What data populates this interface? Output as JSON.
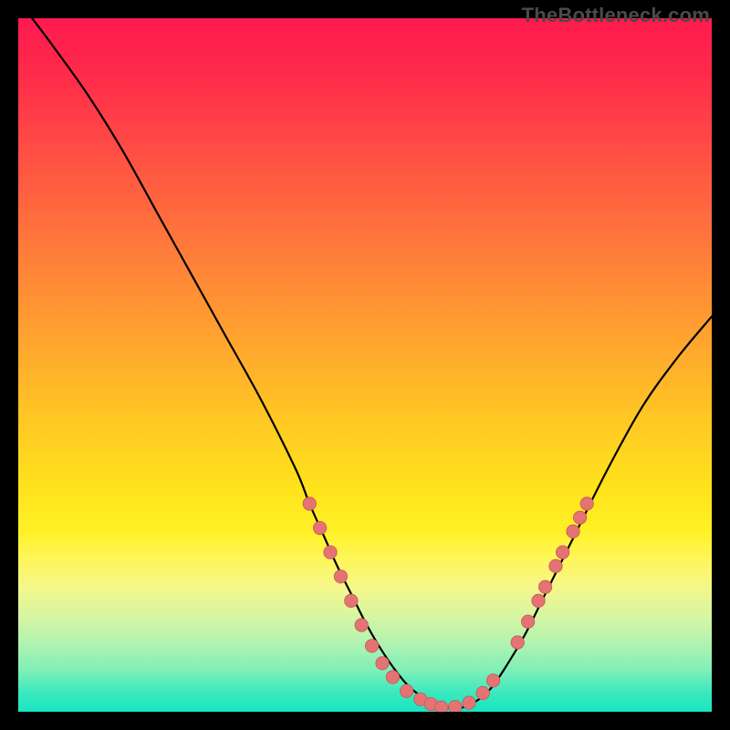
{
  "watermark": "TheBottleneck.com",
  "colors": {
    "background": "#000000",
    "gradient_top": "#ff1a4f",
    "gradient_bottom": "#16e6c0",
    "curve": "#000000",
    "dot_fill": "#e57373",
    "dot_stroke": "#c45a5a"
  },
  "chart_data": {
    "type": "line",
    "title": "",
    "xlabel": "",
    "ylabel": "",
    "xlim": [
      0,
      100
    ],
    "ylim": [
      0,
      100
    ],
    "grid": false,
    "legend": false,
    "series": [
      {
        "name": "bottleneck-curve",
        "x": [
          2,
          5,
          10,
          15,
          20,
          25,
          30,
          35,
          40,
          42,
          44,
          46,
          48,
          50,
          52,
          54,
          56,
          58,
          60,
          62,
          64,
          66,
          68,
          70,
          73,
          76,
          80,
          85,
          90,
          95,
          100
        ],
        "y": [
          100,
          96,
          89,
          81,
          72,
          63,
          54,
          45,
          35,
          30,
          25.5,
          21,
          17,
          13,
          9.5,
          6.5,
          4,
          2.3,
          1.2,
          0.6,
          0.6,
          1.5,
          3.2,
          6,
          11,
          17,
          25,
          35,
          44,
          51,
          57
        ]
      }
    ],
    "highlight_dots": {
      "name": "marked-points",
      "points": [
        {
          "x": 42,
          "y": 30
        },
        {
          "x": 43.5,
          "y": 26.5
        },
        {
          "x": 45,
          "y": 23
        },
        {
          "x": 46.5,
          "y": 19.5
        },
        {
          "x": 48,
          "y": 16
        },
        {
          "x": 49.5,
          "y": 12.5
        },
        {
          "x": 51,
          "y": 9.5
        },
        {
          "x": 52.5,
          "y": 7
        },
        {
          "x": 54,
          "y": 5
        },
        {
          "x": 56,
          "y": 3
        },
        {
          "x": 58,
          "y": 1.8
        },
        {
          "x": 59.5,
          "y": 1.1
        },
        {
          "x": 61,
          "y": 0.6
        },
        {
          "x": 63,
          "y": 0.7
        },
        {
          "x": 65,
          "y": 1.3
        },
        {
          "x": 67,
          "y": 2.7
        },
        {
          "x": 68.5,
          "y": 4.5
        },
        {
          "x": 72,
          "y": 10
        },
        {
          "x": 73.5,
          "y": 13
        },
        {
          "x": 75,
          "y": 16
        },
        {
          "x": 76,
          "y": 18
        },
        {
          "x": 77.5,
          "y": 21
        },
        {
          "x": 78.5,
          "y": 23
        },
        {
          "x": 80,
          "y": 26
        },
        {
          "x": 81,
          "y": 28
        },
        {
          "x": 82,
          "y": 30
        }
      ]
    }
  }
}
